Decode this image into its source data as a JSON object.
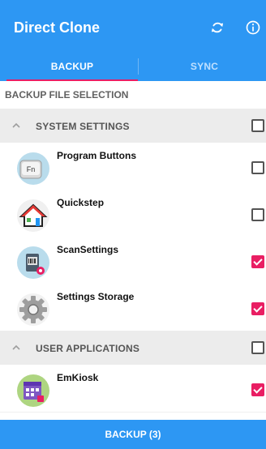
{
  "app": {
    "title": "Direct Clone"
  },
  "tabs": [
    {
      "label": "BACKUP",
      "active": true
    },
    {
      "label": "SYNC",
      "active": false
    }
  ],
  "section_title": "BACKUP FILE SELECTION",
  "groups": [
    {
      "label": "SYSTEM SETTINGS",
      "checked": false,
      "items": [
        {
          "name": "Program Buttons",
          "checked": false,
          "icon": "fn-key-icon"
        },
        {
          "name": "Quickstep",
          "checked": false,
          "icon": "house-icon"
        },
        {
          "name": "ScanSettings",
          "checked": true,
          "icon": "scanner-gear-icon"
        },
        {
          "name": "Settings Storage",
          "checked": true,
          "icon": "gear-icon"
        }
      ]
    },
    {
      "label": "USER APPLICATIONS",
      "checked": false,
      "items": [
        {
          "name": "EmKiosk",
          "checked": true,
          "icon": "kiosk-calendar-icon"
        }
      ]
    }
  ],
  "bottom_button": {
    "label": "BACKUP (3)"
  },
  "colors": {
    "primary": "#2d97f3",
    "accent": "#e91e63",
    "header_bg": "#ececec"
  }
}
